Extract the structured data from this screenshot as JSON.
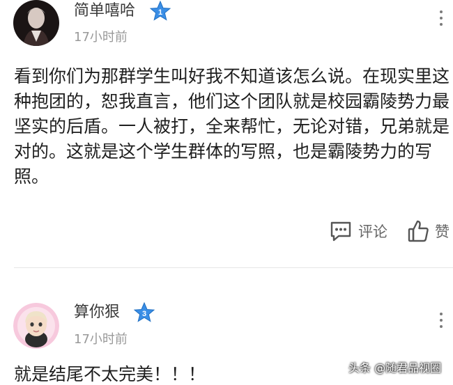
{
  "comments": [
    {
      "username": "简单嘻哈",
      "badge_level": "1",
      "time": "17小时前",
      "text": "看到你们为那群学生叫好我不知道该怎么说。在现实里这种抱团的，恕我直言，他们这个团队就是校园霸陵势力最坚实的后盾。一人被打，全来帮忙，无论对错，兄弟就是对的。这就是这个学生群体的写照，也是霸陵势力的写照。",
      "reply_label": "评论",
      "like_label": "赞",
      "avatar_icon": "user-avatar-icon",
      "reply_icon": "comment-bubble-icon",
      "like_icon": "thumbs-up-icon"
    },
    {
      "username": "算你狠",
      "badge_level": "3",
      "time": "17小时前",
      "text": "就是结尾不太完美！！！",
      "avatar_icon": "user-avatar-icon"
    }
  ],
  "watermark": "头条 @随君品视圈",
  "colors": {
    "badge_star": "#3a8ee6",
    "text": "#1e1e1e",
    "muted": "#999999",
    "divider": "#e6e6e6"
  }
}
